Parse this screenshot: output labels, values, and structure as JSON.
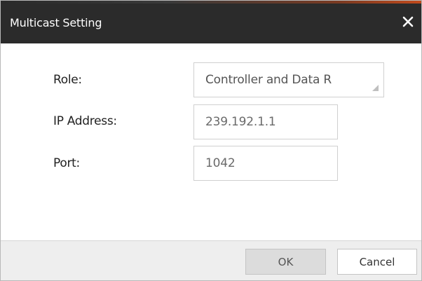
{
  "dialog": {
    "title": "Multicast Setting",
    "close_icon": "close-icon"
  },
  "form": {
    "role_label": "Role:",
    "role_value": "Controller and Data R",
    "ip_label": "IP Address:",
    "ip_value": "239.192.1.1",
    "port_label": "Port:",
    "port_value": "1042"
  },
  "footer": {
    "ok_label": "OK",
    "cancel_label": "Cancel"
  },
  "colors": {
    "titlebar_bg": "#2b2b2b",
    "accent": "#c24a1c",
    "footer_bg": "#eeeeee"
  }
}
